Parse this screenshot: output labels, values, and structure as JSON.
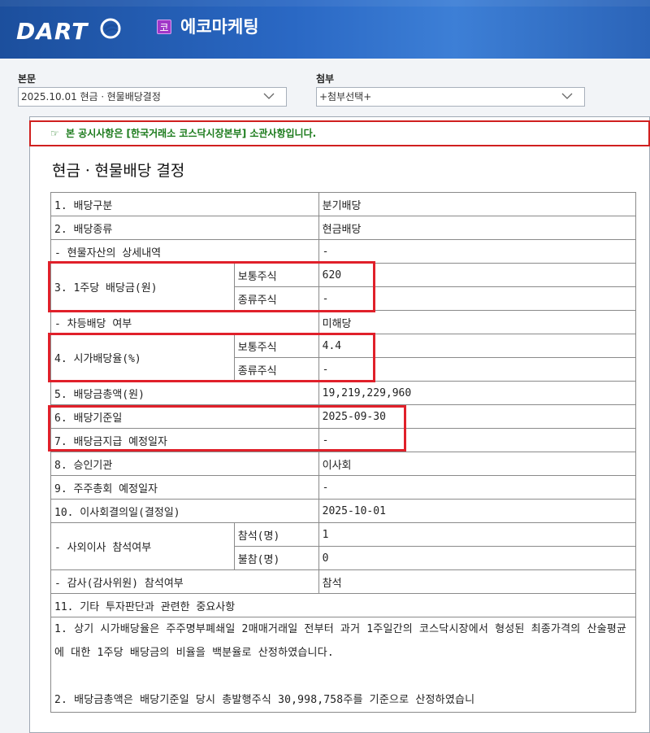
{
  "header": {
    "logo_text": "DART",
    "market_badge": "코",
    "company_name": "에코마케팅"
  },
  "selectors": {
    "body_label": "본문",
    "body_value": "2025.10.01  현금ㆍ현물배당결정",
    "attach_label": "첨부",
    "attach_value": "+첨부선택+"
  },
  "notice": {
    "icon": "pointing-hand-icon",
    "text": "본 공시사항은 [한국거래소 코스닥시장본부] 소관사항입니다."
  },
  "doc": {
    "title": "현금ㆍ현물배당 결정",
    "rows": {
      "r1_label": "1. 배당구분",
      "r1_value": "분기배당",
      "r2_label": "2. 배당종류",
      "r2_value": "현금배당",
      "r3_label": "- 현물자산의 상세내역",
      "r3_value": "-",
      "r4_label": "3. 1주당 배당금(원)",
      "r4_sub1": "보통주식",
      "r4_val1": "620",
      "r4_sub2": "종류주식",
      "r4_val2": "-",
      "r5_label": "- 차등배당 여부",
      "r5_value": "미해당",
      "r6_label": "4. 시가배당율(%)",
      "r6_sub1": "보통주식",
      "r6_val1": "4.4",
      "r6_sub2": "종류주식",
      "r6_val2": "-",
      "r7_label": "5. 배당금총액(원)",
      "r7_value": "19,219,229,960",
      "r8_label": "6. 배당기준일",
      "r8_value": "2025-09-30",
      "r9_label": "7. 배당금지급 예정일자",
      "r9_value": "-",
      "r10_label": "8. 승인기관",
      "r10_value": "이사회",
      "r11_label": "9. 주주총회 예정일자",
      "r11_value": "-",
      "r12_label": "10. 이사회결의일(결정일)",
      "r12_value": "2025-10-01",
      "r13_label": "- 사외이사 참석여부",
      "r13_sub1": "참석(명)",
      "r13_val1": "1",
      "r13_sub2": "불참(명)",
      "r13_val2": "0",
      "r14_label": "- 감사(감사위원) 참석여부",
      "r14_value": "참석",
      "r15_label": "11. 기타 투자판단과 관련한 중요사항",
      "r16_text": "1. 상기 시가배당율은 주주명부폐쇄일 2매매거래일 전부터 과거 1주일간의 코스닥시장에서 형성된 최종가격의 산술평균에 대한 1주당 배당금의 비율을 백분율로 산정하였습니다.",
      "r17_text": "2. 배당금총액은 배당기준일 당시 총발행주식 30,998,758주를 기준으로 산정하였습니"
    }
  },
  "colors": {
    "header_blue": "#2a68c4",
    "notice_border": "#d0201f",
    "notice_text": "#1a7a1a",
    "highlight_red": "#e0202a",
    "badge_purple": "#a036c8"
  }
}
